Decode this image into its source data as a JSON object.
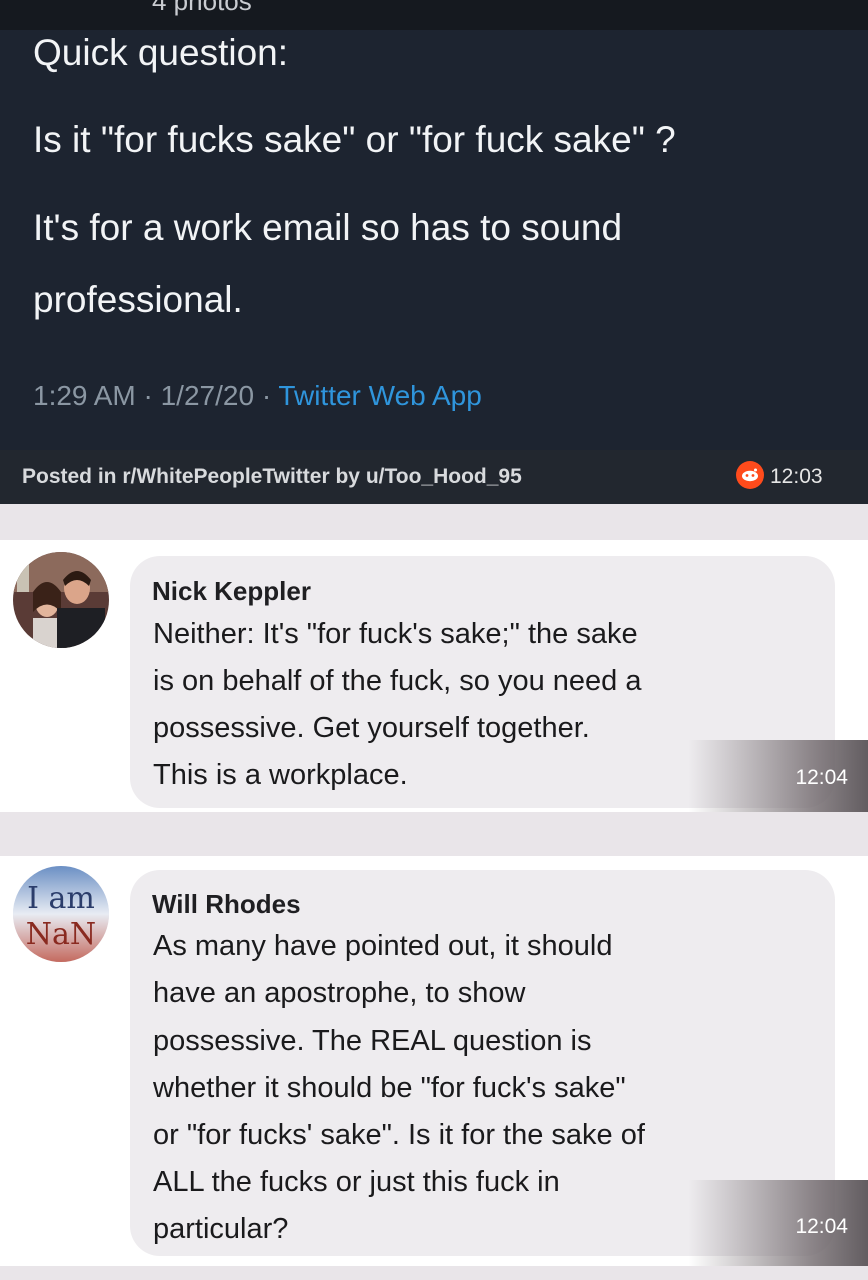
{
  "tweet": {
    "photos_label": "4 photos",
    "lines": [
      "Quick question:",
      "Is it \"for fucks sake\" or \"for fuck sake\" ?",
      "It's for a work email so has to sound",
      "professional."
    ],
    "time": "1:29 AM · 1/27/20 · ",
    "source": "Twitter Web App",
    "colors": {
      "background": "#1d2430",
      "source_link": "#2f95dc"
    }
  },
  "reddit": {
    "posted_text": "Posted in r/WhitePeopleTwitter by u/Too_Hood_95",
    "time": "12:03",
    "icon": "reddit-icon",
    "accent": "#ff4b1c"
  },
  "comments": [
    {
      "name": "Nick Keppler",
      "lines": [
        "Neither: It's \"for fuck's sake;\" the sake",
        "is on behalf of the fuck, so you need a",
        "possessive. Get yourself together.",
        "This is a workplace."
      ],
      "time": "12:04",
      "avatar": "photo-avatar"
    },
    {
      "name": "Will Rhodes",
      "lines": [
        "As many have pointed out, it should",
        "have an apostrophe, to show",
        "possessive. The REAL question is",
        "whether it should be \"for fuck's sake\"",
        "or \"for fucks' sake\". Is it for the sake of",
        "ALL the fucks or just this fuck in",
        "particular?"
      ],
      "time": "12:04",
      "avatar": "text-avatar"
    }
  ]
}
